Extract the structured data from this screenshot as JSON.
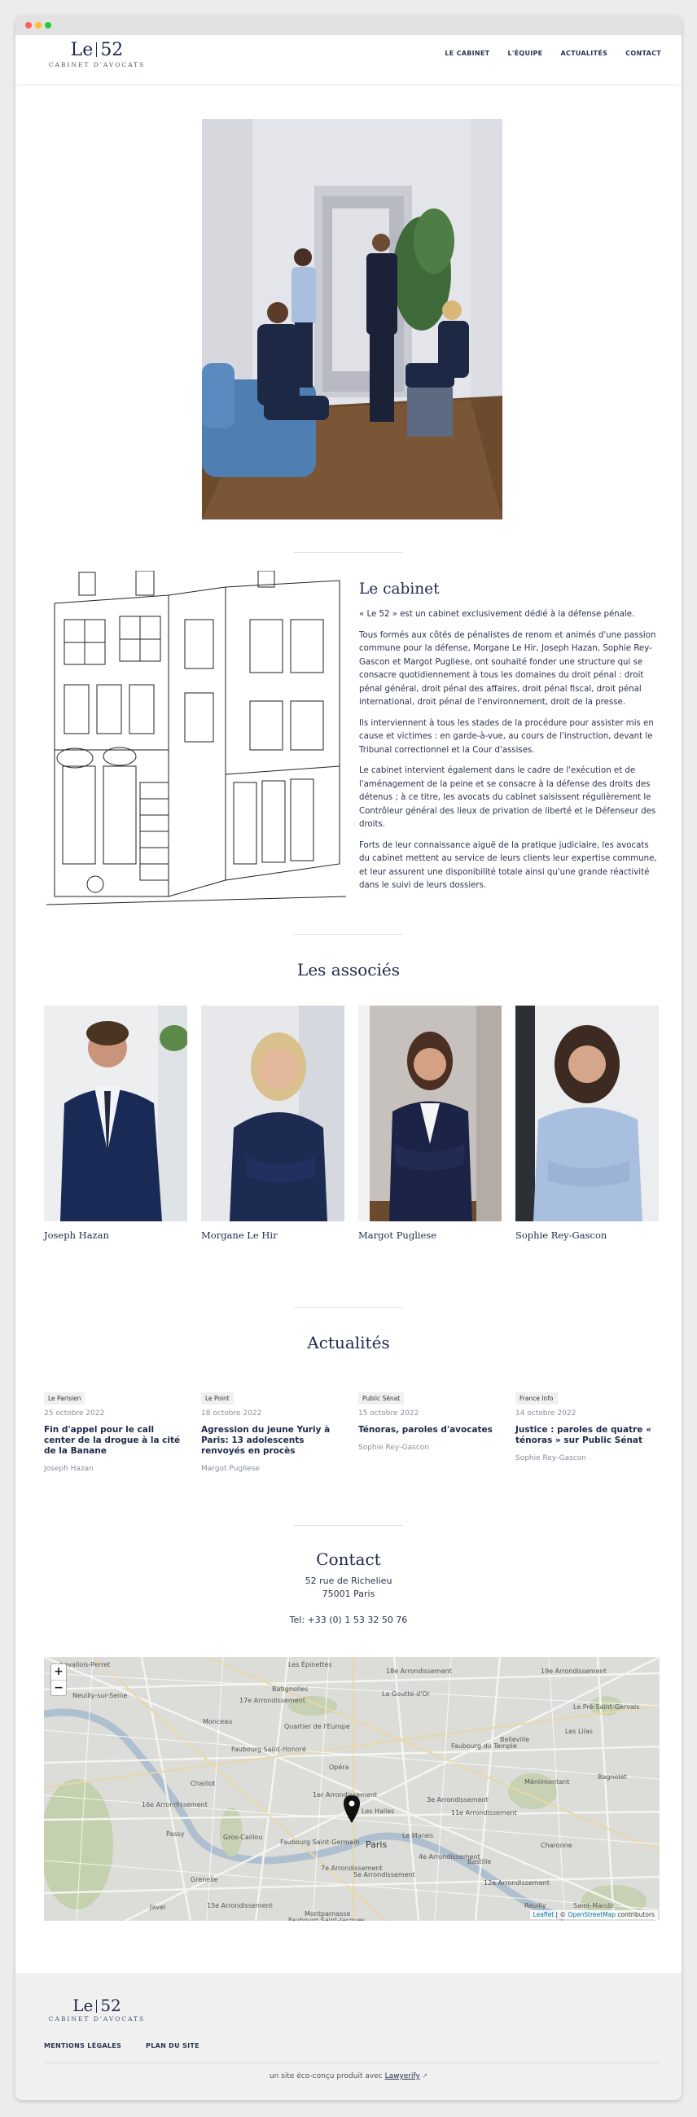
{
  "header": {
    "logo_main": "Le 52",
    "logo_left": "Le",
    "logo_right": "52",
    "logo_sub": "CABINET D'AVOCATS",
    "nav": [
      "LE CABINET",
      "L'ÉQUIPE",
      "ACTUALITÉS",
      "CONTACT"
    ]
  },
  "cabinet": {
    "title": "Le cabinet",
    "paragraphs": [
      "« Le 52 » est un cabinet exclusivement dédié à la défense pénale.",
      "Tous formés aux côtés de pénalistes de renom et animés d'une passion commune pour la défense, Morgane Le Hir, Joseph Hazan, Sophie Rey-Gascon et Margot Pugliese, ont souhaité fonder une structure qui se consacre quotidiennement à tous les domaines du droit pénal : droit pénal général, droit pénal des affaires, droit pénal fiscal, droit pénal international, droit pénal de l'environnement, droit de la presse.",
      "Ils interviennent à tous les stades de la procédure pour assister mis en cause et victimes : en garde-à-vue, au cours de l'instruction, devant le Tribunal correctionnel et la Cour d'assises.",
      "Le cabinet intervient également dans le cadre de l'exécution et de l'aménagement de la peine et se consacre à la défense des droits des détenus ; à ce titre, les avocats du cabinet saisissent régulièrement le Contrôleur général des lieux de privation de liberté et le Défenseur des droits.",
      "Forts de leur connaissance aiguë de la pratique judiciaire, les avocats du cabinet mettent au service de leurs clients leur expertise commune, et leur assurent une disponibilité totale ainsi qu'une grande réactivité dans le suivi de leurs dossiers."
    ]
  },
  "associates": {
    "title": "Les associés",
    "people": [
      {
        "name": "Joseph Hazan"
      },
      {
        "name": "Morgane Le Hir"
      },
      {
        "name": "Margot Pugliese"
      },
      {
        "name": "Sophie Rey-Gascon"
      }
    ]
  },
  "news": {
    "title": "Actualités",
    "items": [
      {
        "source": "Le Parisien",
        "date": "25 octobre 2022",
        "title": "Fin d'appel pour le call center de la drogue à la cité de la Banane",
        "author": "Joseph Hazan"
      },
      {
        "source": "Le Point",
        "date": "18 octobre 2022",
        "title": "Agression du jeune Yuriy à Paris: 13 adolescents renvoyés en procès",
        "author": "Margot Pugliese"
      },
      {
        "source": "Public Sénat",
        "date": "15 octobre 2022",
        "title": "Ténoras, paroles d'avocates",
        "author": "Sophie Rey-Gascon"
      },
      {
        "source": "France Info",
        "date": "14 octobre 2022",
        "title": "Justice : paroles de quatre « ténoras » sur Public Sénat",
        "author": "Sophie Rey-Gascon"
      }
    ]
  },
  "contact": {
    "title": "Contact",
    "address1": "52 rue de Richelieu",
    "address2": "75001 Paris",
    "tel": "Tel: +33 (0) 1 53 32 50 76"
  },
  "map": {
    "zoom_in": "+",
    "zoom_out": "−",
    "attribution_leaflet": "Leaflet",
    "attribution_sep": " | © ",
    "attribution_osm": "OpenStreetMap",
    "attribution_tail": " contributors",
    "labels": [
      "Levallois-Perret",
      "Les Épinettes",
      "18e Arrondissement",
      "19e Arrondissement",
      "Neuilly-sur-Seine",
      "Batignolles",
      "La Goutte-d'Or",
      "17e Arrondissement",
      "Le Pré-Saint-Gervais",
      "Monceau",
      "Quartier de l'Europe",
      "Les Lilas",
      "Faubourg Saint-Honoré",
      "Faubourg du Temple",
      "Belleville",
      "Chaillot",
      "Opéra",
      "Ménilmontant",
      "Bagnolet",
      "16e Arrondissement",
      "1er Arrondissement",
      "3e Arrondissement",
      "Les Halles",
      "11e Arrondissement",
      "Passy",
      "Gros-Caillou",
      "Faubourg Saint-Germain",
      "Le Marais",
      "Paris",
      "Charonne",
      "7e Arrondissement",
      "4e Arrondissement",
      "Bastille",
      "Grenelle",
      "5e Arrondissement",
      "12e Arrondissement",
      "Javel",
      "15e Arrondissement",
      "Montparnasse",
      "Reuilly",
      "Saint-Mandé",
      "Faubourg Saint-Jacques"
    ]
  },
  "footer": {
    "links": [
      "MENTIONS LÉGALES",
      "PLAN DU SITE"
    ],
    "credit_prefix": "un site éco-conçu produit avec ",
    "credit_link": "Lawyerify"
  },
  "colors": {
    "navy": "#1f2a4a",
    "text": "#2b3450",
    "footer_bg": "#f0f0f0"
  }
}
